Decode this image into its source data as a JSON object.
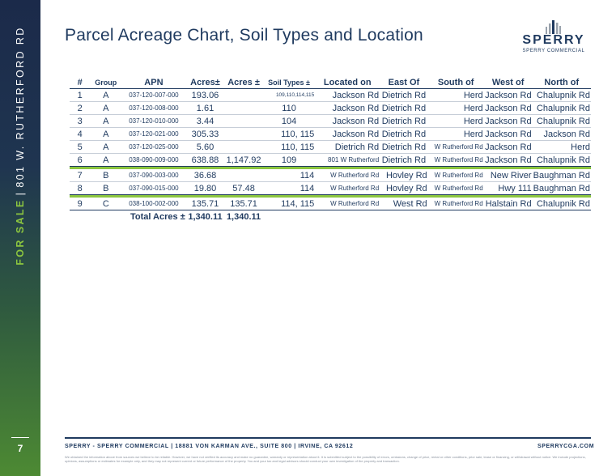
{
  "sidebar": {
    "label_a": "FOR SALE",
    "separator": "|",
    "label_b": "801 W. RUTHERFORD RD",
    "page_number": "7"
  },
  "page": {
    "title": "Parcel Acreage Chart, Soil Types and Location"
  },
  "logo": {
    "word": "SPERRY",
    "sub": "SPERRY COMMERCIAL"
  },
  "table": {
    "headers": [
      "#",
      "Group",
      "APN",
      "Acres±",
      "Acres ±",
      "Soil Types ±",
      "Located on",
      "East Of",
      "South of",
      "West of",
      "North of"
    ],
    "group_a": [
      {
        "num": "1",
        "group": "A",
        "apn": "037-120-007-000",
        "acres": "193.06",
        "acres_total": "",
        "soil": "109,110,114,115",
        "located": "Jackson Rd",
        "east": "Dietrich Rd",
        "south": "Herd",
        "west": "Jackson Rd",
        "north": "Chalupnik Rd"
      },
      {
        "num": "2",
        "group": "A",
        "apn": "037-120-008-000",
        "acres": "1.61",
        "acres_total": "",
        "soil": "110",
        "located": "Jackson Rd",
        "east": "Dietrich Rd",
        "south": "Herd",
        "west": "Jackson Rd",
        "north": "Chalupnik Rd"
      },
      {
        "num": "3",
        "group": "A",
        "apn": "037-120-010-000",
        "acres": "3.44",
        "acres_total": "",
        "soil": "104",
        "located": "Jackson Rd",
        "east": "Dietrich Rd",
        "south": "Herd",
        "west": "Jackson Rd",
        "north": "Chalupnik Rd"
      },
      {
        "num": "4",
        "group": "A",
        "apn": "037-120-021-000",
        "acres": "305.33",
        "acres_total": "",
        "soil": "110, 115",
        "located": "Jackson Rd",
        "east": "Dietrich Rd",
        "south": "Herd",
        "west": "Jackson Rd",
        "north": "Jackson Rd"
      },
      {
        "num": "5",
        "group": "A",
        "apn": "037-120-025-000",
        "acres": "5.60",
        "acres_total": "",
        "soil": "110, 115",
        "located": "Dietrich Rd",
        "east": "Dietrich Rd",
        "south": "W Rutherford Rd",
        "west": "Jackson Rd",
        "north": "Herd"
      },
      {
        "num": "6",
        "group": "A",
        "apn": "038-090-009-000",
        "acres": "638.88",
        "acres_total": "1,147.92",
        "soil": "109",
        "located": "801 W Rutherford",
        "east": "Dietrich Rd",
        "south": "W Rutherford Rd",
        "west": "Jackson Rd",
        "north": "Chalupnik Rd"
      }
    ],
    "group_b": [
      {
        "num": "7",
        "group": "B",
        "apn": "037-090-003-000",
        "acres": "36.68",
        "acres_total": "",
        "soil": "114",
        "located": "W Rutherford Rd",
        "east": "Hovley Rd",
        "south": "W Rutherford Rd",
        "west": "New River",
        "north": "Baughman Rd"
      },
      {
        "num": "8",
        "group": "B",
        "apn": "037-090-015-000",
        "acres": "19.80",
        "acres_total": "57.48",
        "soil": "114",
        "located": "W Rutherford Rd",
        "east": "Hovley Rd",
        "south": "W Rutherford Rd",
        "west": "Hwy 111",
        "north": "Baughman Rd"
      }
    ],
    "group_c": [
      {
        "num": "9",
        "group": "C",
        "apn": "038-100-002-000",
        "acres": "135.71",
        "acres_total": "135.71",
        "soil": "114, 115",
        "located": "W Rutherford Rd",
        "east": "West Rd",
        "south": "W Rutherford Rd",
        "west": "Halstain Rd",
        "north": "Chalupnik Rd"
      }
    ],
    "total_label": "Total Acres ±",
    "total_acres": "1,340.11",
    "total_acres_2": "1,340.11"
  },
  "footer": {
    "left": "SPERRY - SPERRY COMMERCIAL | 18881 VON KARMAN AVE., SUITE 800 | IRVINE, CA 92612",
    "right": "SPERRYCGA.COM",
    "disclaimer": "We obtained the information above from sources we believe to be reliable. However, we have not verified its accuracy and make no guarantee, warranty or representation about it. It is submitted subject to the possibility of errors, omissions, change of price, rental or other conditions, prior sale, lease or financing, or withdrawal without notice. We include projections, opinions, assumptions or estimates for example only, and they may not represent current or future performance of the property. You and your tax and legal advisors should conduct your own investigation of the property and transaction."
  },
  "colors": {
    "navy": "#1f3a5f",
    "green": "#8cc63f",
    "sidebar_top": "#1b2a4a",
    "sidebar_bottom": "#4d8a33"
  }
}
